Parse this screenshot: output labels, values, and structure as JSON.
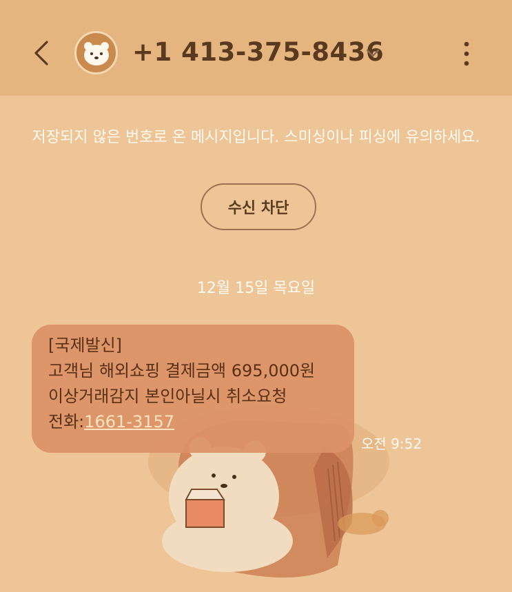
{
  "header": {
    "back_icon": "chevron-left-icon",
    "avatar_icon": "bear-face-icon",
    "phone_number": "+1 413-375-8436",
    "expand_icon": "chevron-down-icon",
    "more_icon": "more-vertical-icon"
  },
  "notice": {
    "warning_text": "저장되지 않은 번호로 온 메시지입니다. 스미싱이나 피싱에 유의하세요.",
    "block_label": "수신 차단"
  },
  "conversation": {
    "date": "12월 15일 목요일",
    "messages": [
      {
        "lines": [
          "[국제발신]",
          "고객님 해외쇼핑 결제금액 695,000원",
          "이상거래감지 본인아닐시 취소요청"
        ],
        "last_line_prefix": "전화:",
        "link_text": "1661-3157",
        "time": "오전 9:52"
      }
    ]
  },
  "colors": {
    "background": "#edc597",
    "header": "#e5b57f",
    "bubble": "#db9166",
    "text_dark": "#5a3a1e"
  }
}
